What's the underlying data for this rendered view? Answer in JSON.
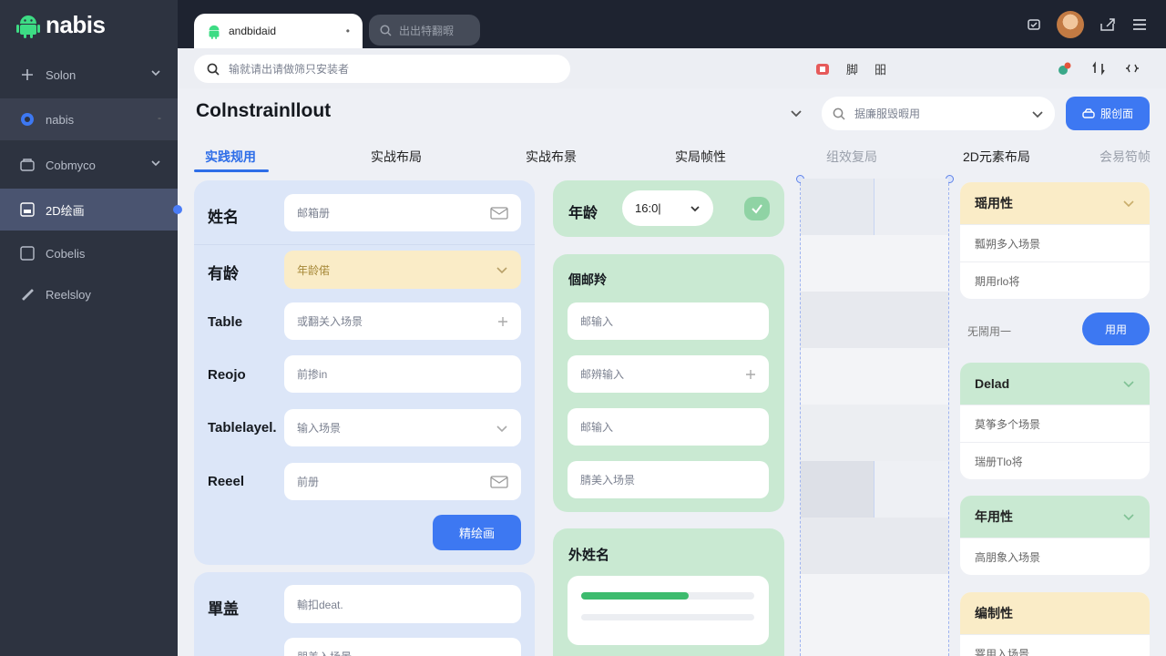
{
  "app": {
    "logo_text": "nabis"
  },
  "sidebar": {
    "items": [
      {
        "label": "Solon",
        "icon": "plus-icon"
      },
      {
        "label": "nabis",
        "icon": "circle-icon"
      },
      {
        "label": "Cobmyco",
        "icon": "folder-icon"
      },
      {
        "label": "2D绘画",
        "icon": "image-icon"
      },
      {
        "label": "Cobelis",
        "icon": "square-icon"
      },
      {
        "label": "Reelsloy",
        "icon": "brush-icon"
      }
    ]
  },
  "topbar": {
    "tab_label": "andbidaid",
    "search_placeholder": "出出特翻暇"
  },
  "subbar": {
    "search_placeholder": "输就请出请做筛只安装者",
    "mid_items": [
      "脚",
      "昍"
    ]
  },
  "header": {
    "title": "Colnstrainllout",
    "search_placeholder": "据廉服毁暇用",
    "button_label": "服创面"
  },
  "tabs": [
    "实践规用",
    "实战布局",
    "实战布景",
    "实局帧性",
    "组效复局",
    "2D元素布局",
    "会易笱帧"
  ],
  "form": {
    "rows": [
      {
        "label": "姓名",
        "placeholder": "邮箱册"
      },
      {
        "label": "有龄",
        "placeholder": "年龄偌"
      },
      {
        "label": "Table",
        "placeholder": "或翻关入场景"
      },
      {
        "label": "Reojo",
        "placeholder": "前掺in"
      },
      {
        "label": "Tablelayel.",
        "placeholder": "输入场景"
      },
      {
        "label": "Reeel",
        "placeholder": "前册"
      }
    ],
    "submit_label": "精绘画",
    "row2_label": "單盖",
    "row2_placeholder": "輸扣deat.",
    "row3_placeholder": "朋美入场景"
  },
  "green": {
    "age_label": "年龄",
    "age_value": "16:0|",
    "card_title": "個邮羚",
    "inputs": [
      "邮输入",
      "邮辨输入",
      "邮输入",
      "腈美入场景"
    ],
    "card2_title": "外姓名",
    "progress": 0.62
  },
  "right": {
    "card1": {
      "title": "瑶用性",
      "rows": [
        "瓢朔多入场景",
        "期用rlo将"
      ]
    },
    "mid_label": "旡鬧用一",
    "mid_button": "用用",
    "card2": {
      "title": "Delad",
      "rows": [
        "莫筝多个场景",
        "瑞册Tlo将"
      ]
    },
    "card3": {
      "title": "年用性",
      "rows": [
        "高朋象入场景"
      ]
    },
    "card4": {
      "title": "编制性",
      "rows": [
        "罯用入场景"
      ]
    }
  },
  "colors": {
    "accent": "#3d78f2",
    "sidebar": "#2d3340",
    "blue_panel": "#dce6f8",
    "green_panel": "#c9e9d2",
    "yellow": "#faecc7"
  }
}
